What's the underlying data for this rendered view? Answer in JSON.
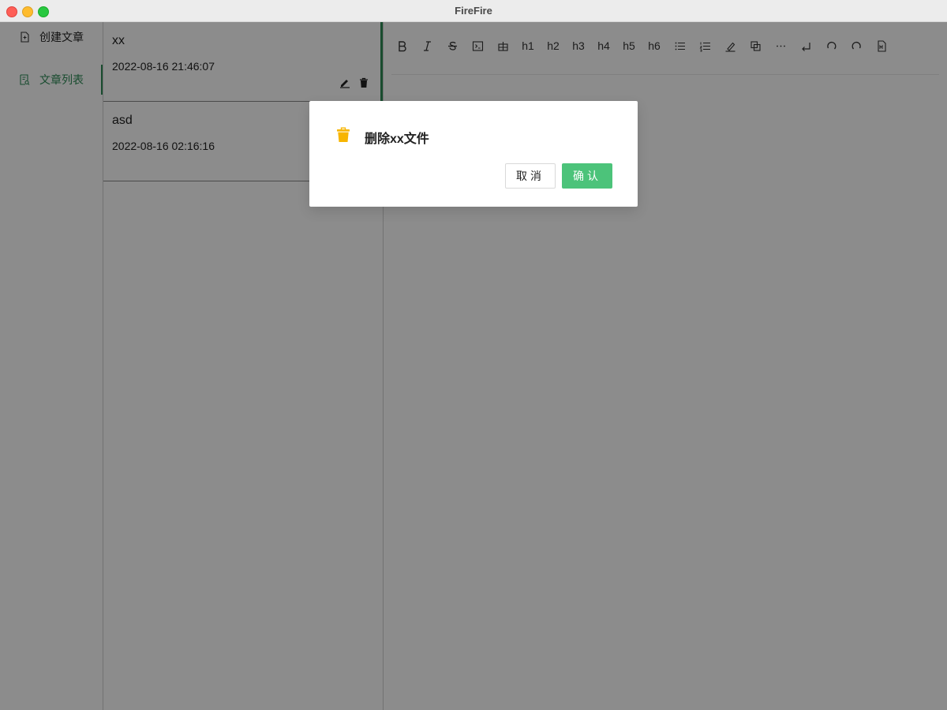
{
  "window": {
    "title": "FireFire"
  },
  "sidebar": {
    "items": [
      {
        "label": "创建文章",
        "icon": "file-add-icon"
      },
      {
        "label": "文章列表",
        "icon": "file-list-icon",
        "active": true
      }
    ]
  },
  "articles": [
    {
      "title": "xx",
      "date": "2022-08-16 21:46:07"
    },
    {
      "title": "asd",
      "date": "2022-08-16 02:16:16"
    }
  ],
  "toolbar": {
    "items": [
      "bold-icon",
      "italic-icon",
      "strikethrough-icon",
      "code-icon",
      "table-icon",
      "h1",
      "h2",
      "h3",
      "h4",
      "h5",
      "h6",
      "unordered-list-icon",
      "ordered-list-icon",
      "highlight-icon",
      "copy-icon",
      "divider-icon",
      "line-break-icon",
      "undo-icon",
      "redo-icon",
      "markdown-icon"
    ],
    "headings": [
      "h1",
      "h2",
      "h3",
      "h4",
      "h5",
      "h6"
    ]
  },
  "modal": {
    "title": "删除xx文件",
    "cancel_label": "取消",
    "confirm_label": "确认",
    "icon": "trash-icon",
    "icon_color": "#f7b500",
    "confirm_color": "#4cc37a"
  },
  "colors": {
    "accent": "#2e8b57"
  }
}
